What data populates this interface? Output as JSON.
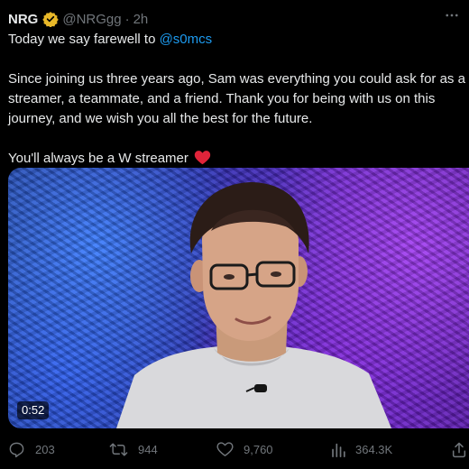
{
  "tweet": {
    "author_name": "NRG",
    "handle": "@NRGgg",
    "separator": "·",
    "time": "2h",
    "line1_prefix": "Today we say farewell to ",
    "mention": "@s0mcs",
    "line2": "Since joining us three years ago, Sam was everything you could ask for as a",
    "line3": "streamer, a teammate, and a friend. Thank you for being with us on this",
    "line4": "journey, and we wish you all the best for the future.",
    "line5": "You'll always be a W streamer",
    "icons": {
      "verified": "verified-gold-badge-icon",
      "more": "more-options-icon",
      "emoji": "red-heart-emoji"
    },
    "colors": {
      "mention": "#1d9bf0",
      "verified": "#e8b829",
      "heart": "#e0243a"
    }
  },
  "media": {
    "duration": "0:52"
  },
  "actions": {
    "replies": "203",
    "reposts": "944",
    "likes": "9,760",
    "views": "364.3K"
  }
}
